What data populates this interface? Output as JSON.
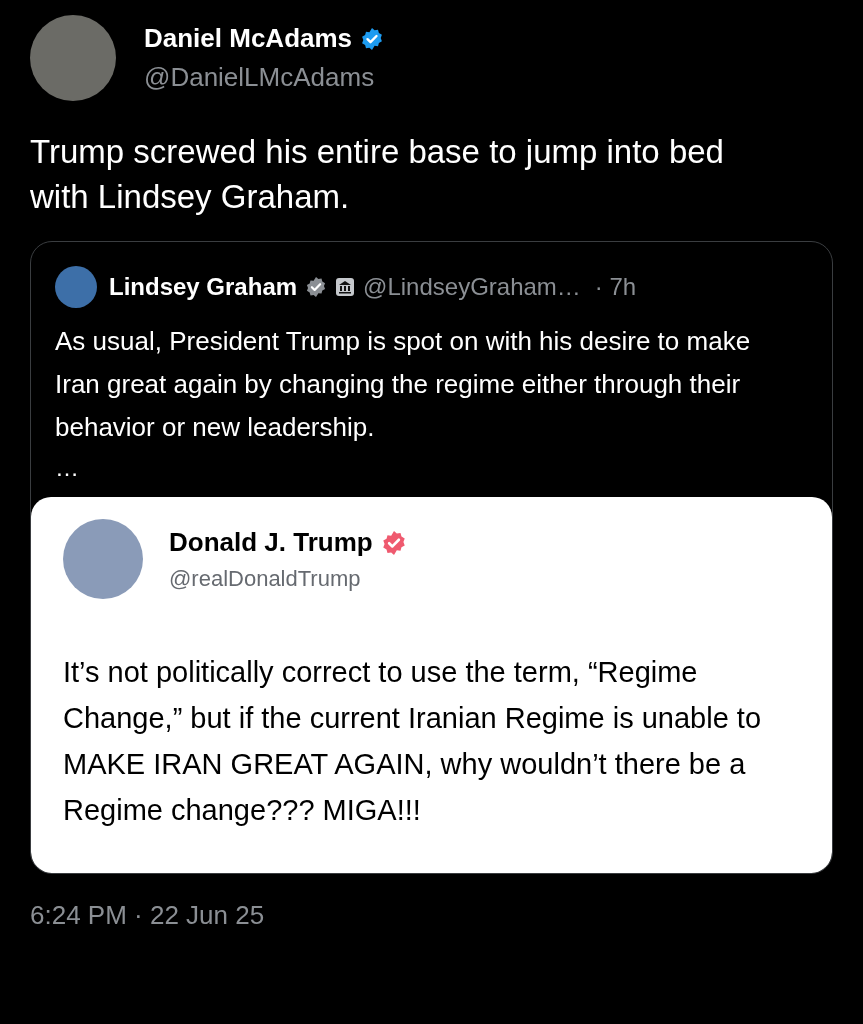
{
  "tweet": {
    "author": {
      "name": "Daniel McAdams",
      "handle": "@DanielLMcAdams",
      "verified": true
    },
    "text": "Trump screwed his entire base to jump into bed with Lindsey Graham.",
    "quote": {
      "author": {
        "name": "Lindsey Graham",
        "verified": true,
        "government": true,
        "handle": "@LindseyGraham…",
        "time": "· 7h"
      },
      "text": "As usual, President Trump is spot on with his desire to make Iran great again by changing the regime either through their behavior or new leadership.",
      "more": "…",
      "screenshot": {
        "author": {
          "name": "Donald J. Trump",
          "handle": "@realDonaldTrump",
          "verified": true
        },
        "text": "It’s not politically correct to use the term, “Regime Change,” but if the current Iranian Regime is unable to MAKE IRAN GREAT AGAIN, why wouldn’t there be a Regime change??? MIGA!!!"
      }
    },
    "timestamp": "6:24 PM · 22 Jun 25"
  }
}
